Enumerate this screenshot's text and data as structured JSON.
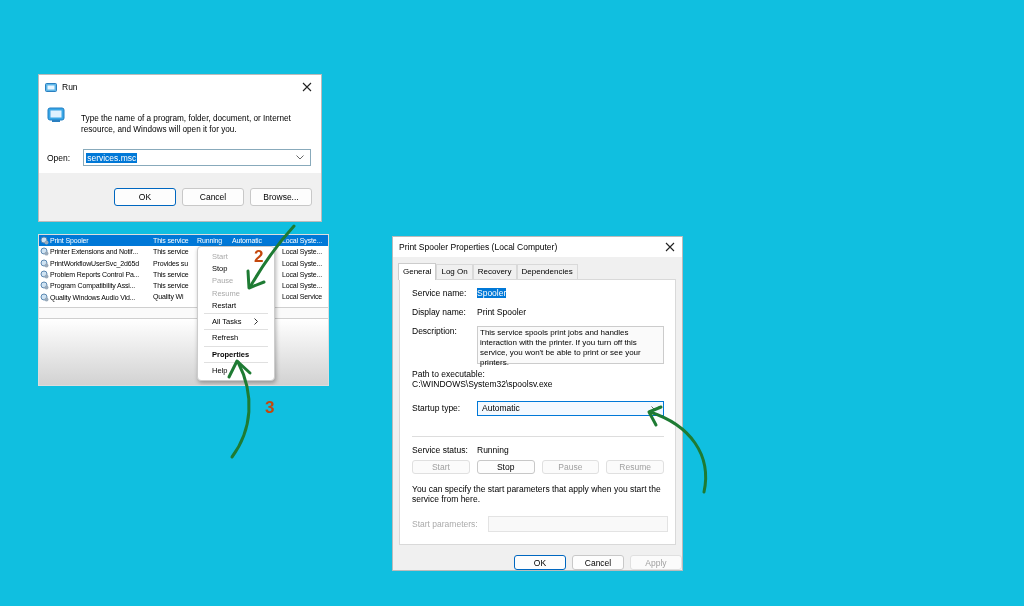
{
  "run_dialog": {
    "title": "Run",
    "prompt": "Type the name of a program, folder, document, or Internet resource, and Windows will open it for you.",
    "open_label": "Open:",
    "open_value": "services.msc",
    "buttons": [
      {
        "label": "OK",
        "default": true
      },
      {
        "label": "Cancel",
        "default": false
      },
      {
        "label": "Browse...",
        "default": false
      }
    ]
  },
  "services_list": {
    "rows": [
      {
        "name": "Print Spooler",
        "description": "This service",
        "status": "Running",
        "startup": "Automatic",
        "log_on": "Local Syste...",
        "selected": true
      },
      {
        "name": "Printer Extensions and Notif...",
        "description": "This service",
        "log_on": "Local Syste...",
        "selected": false
      },
      {
        "name": "PrintWorkflowUserSvc_2d65d",
        "description": "Provides su",
        "log_on": "Local Syste...",
        "selected": false
      },
      {
        "name": "Problem Reports Control Pa...",
        "description": "This service",
        "log_on": "Local Syste...",
        "selected": false
      },
      {
        "name": "Program Compatibility Assi...",
        "description": "This service",
        "log_on": "Local Syste...",
        "selected": false
      },
      {
        "name": "Quality Windows Audio Vid...",
        "description": "Quality Wi",
        "log_on": "Local Service",
        "selected": false
      }
    ],
    "context_menu": [
      {
        "kind": "item",
        "label": "Start",
        "disabled": true,
        "default": false
      },
      {
        "kind": "item",
        "label": "Stop",
        "disabled": false,
        "default": false
      },
      {
        "kind": "item",
        "label": "Pause",
        "disabled": true,
        "default": false
      },
      {
        "kind": "item",
        "label": "Resume",
        "disabled": true,
        "default": false
      },
      {
        "kind": "item",
        "label": "Restart",
        "disabled": false,
        "default": false
      },
      {
        "kind": "separator"
      },
      {
        "kind": "submenu",
        "label": "All Tasks",
        "disabled": false,
        "default": false
      },
      {
        "kind": "separator"
      },
      {
        "kind": "item",
        "label": "Refresh",
        "disabled": false,
        "default": false
      },
      {
        "kind": "separator"
      },
      {
        "kind": "item",
        "label": "Properties",
        "disabled": false,
        "default": true
      },
      {
        "kind": "separator"
      },
      {
        "kind": "item",
        "label": "Help",
        "disabled": false,
        "default": false
      }
    ]
  },
  "properties_dialog": {
    "title": "Print Spooler Properties (Local Computer)",
    "tabs": [
      {
        "label": "General",
        "selected": true
      },
      {
        "label": "Log On",
        "selected": false
      },
      {
        "label": "Recovery",
        "selected": false
      },
      {
        "label": "Dependencies",
        "selected": false
      }
    ],
    "service_name_label": "Service name:",
    "service_name": "Spooler",
    "display_name_label": "Display name:",
    "display_name": "Print Spooler",
    "description_label": "Description:",
    "description": "This service spools print jobs and handles interaction with the printer.  If you turn off this service, you won't be able to print or see your printers.",
    "path_label": "Path to executable:",
    "path": "C:\\WINDOWS\\System32\\spoolsv.exe",
    "startup_label": "Startup type:",
    "startup": "Automatic",
    "status_label": "Service status:",
    "status": "Running",
    "service_buttons": [
      {
        "label": "Start",
        "disabled": true
      },
      {
        "label": "Stop",
        "disabled": false
      },
      {
        "label": "Pause",
        "disabled": true
      },
      {
        "label": "Resume",
        "disabled": true
      }
    ],
    "note": "You can specify the start parameters that apply when you start the service from here.",
    "params_label": "Start parameters:",
    "params_disabled": true,
    "footer_buttons": [
      {
        "label": "OK",
        "default": true,
        "disabled": false
      },
      {
        "label": "Cancel",
        "default": false,
        "disabled": false
      },
      {
        "label": "Apply",
        "default": false,
        "disabled": true
      }
    ]
  },
  "step_numbers": [
    "2",
    "3"
  ]
}
